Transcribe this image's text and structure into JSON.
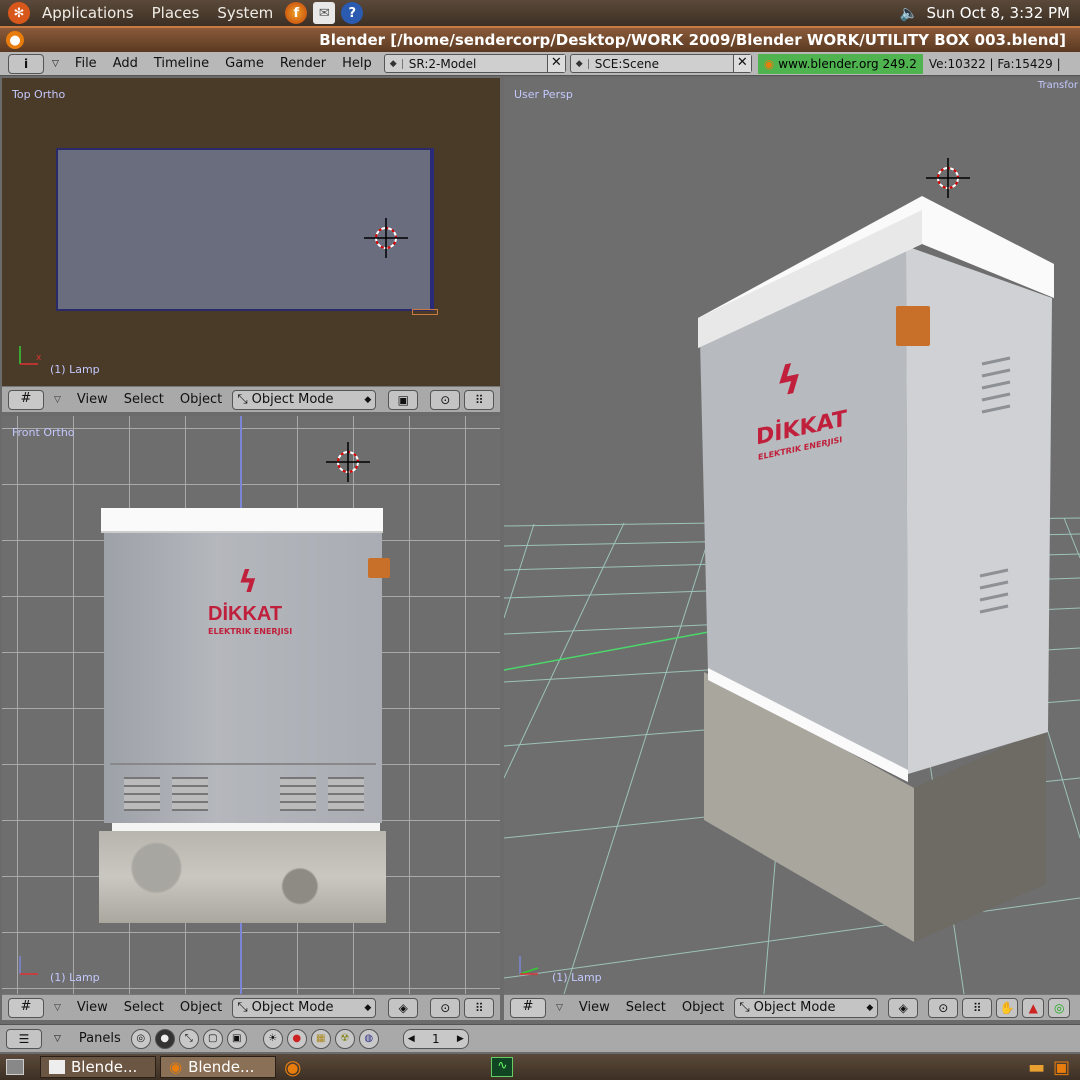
{
  "top_panel": {
    "menus": [
      "Applications",
      "Places",
      "System"
    ],
    "datetime": "Sun Oct  8,  3:32 PM"
  },
  "title_bar": {
    "title": "Blender [/home/sendercorp/Desktop/WORK 2009/Blender WORK/UTILITY BOX 003.blend]"
  },
  "info_header": {
    "menus": [
      "File",
      "Add",
      "Timeline",
      "Game",
      "Render",
      "Help"
    ],
    "screen": "SR:2-Model",
    "scene": "SCE:Scene",
    "url": "www.blender.org 249.2",
    "stats": "Ve:10322 | Fa:15429 |"
  },
  "viewports": {
    "top": {
      "label": "Top Ortho",
      "lamp": "(1) Lamp"
    },
    "front": {
      "label": "Front Ortho",
      "lamp": "(1) Lamp"
    },
    "persp": {
      "label": "User Persp",
      "lamp": "(1) Lamp",
      "corner": "Transfor"
    }
  },
  "viewport_header": {
    "view": "View",
    "select": "Select",
    "object": "Object",
    "mode": "Object Mode"
  },
  "buttons_header": {
    "panels": "Panels",
    "frame": "1"
  },
  "model": {
    "brand": "DİKKAT",
    "subtitle": "ELEKTRIK ENERJISI"
  },
  "taskbar": {
    "tasks": [
      "Blende...",
      "Blende..."
    ]
  },
  "colors": {
    "accent": "#c87a40",
    "url_box": "#4fb34f",
    "viewport_label": "#c4c9ff"
  }
}
